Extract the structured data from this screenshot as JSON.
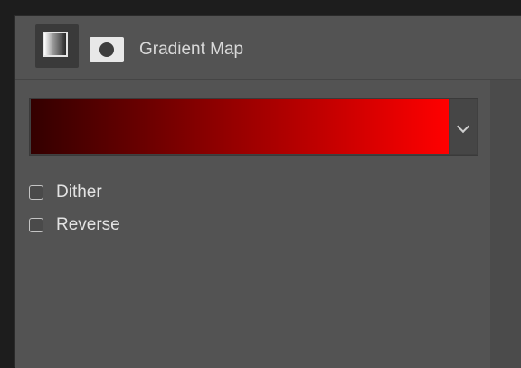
{
  "panel": {
    "title": "Gradient Map",
    "icons": {
      "adjustment": "gradient-map-icon",
      "mask": "layer-mask-icon"
    }
  },
  "gradient": {
    "from_color": "#330000",
    "to_color": "#ff0000",
    "dropdown_icon": "chevron-down-icon"
  },
  "options": {
    "dither": {
      "label": "Dither",
      "checked": false
    },
    "reverse": {
      "label": "Reverse",
      "checked": false
    }
  }
}
